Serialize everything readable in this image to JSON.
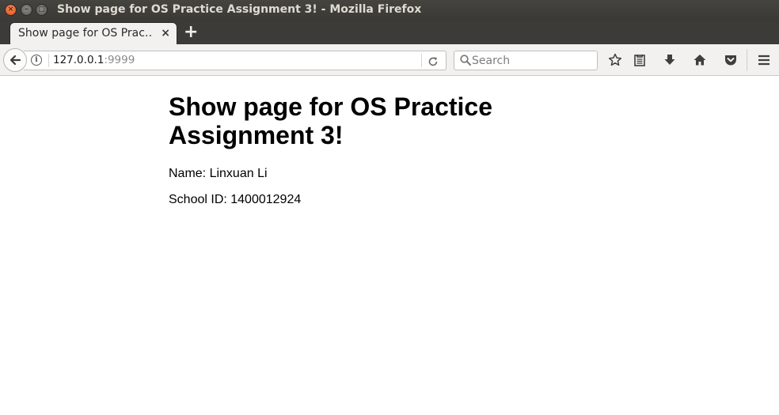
{
  "window": {
    "title": "Show page for OS Practice Assignment 3! - Mozilla Firefox",
    "close_glyph": "×",
    "min_glyph": "–",
    "max_glyph": "□"
  },
  "tabs": [
    {
      "label": "Show page for OS Prac…",
      "close_glyph": "×",
      "active": true
    }
  ],
  "new_tab_glyph": "+",
  "navbar": {
    "url_host": "127.0.0.1",
    "url_port": ":9999",
    "search_placeholder": "Search",
    "icons": [
      "back-arrow-icon",
      "info-icon",
      "reload-icon",
      "search-icon",
      "bookmark-star-icon",
      "reading-list-icon",
      "download-icon",
      "home-icon",
      "pocket-icon",
      "menu-icon"
    ]
  },
  "page": {
    "heading": "Show page for OS Practice Assignment 3!",
    "name_line": "Name: Linxuan Li",
    "school_id_line": "School ID: 1400012924"
  },
  "colors": {
    "titlebar": "#3c3b37",
    "toolbar": "#f2f1f0",
    "close_button": "#e0501c"
  }
}
